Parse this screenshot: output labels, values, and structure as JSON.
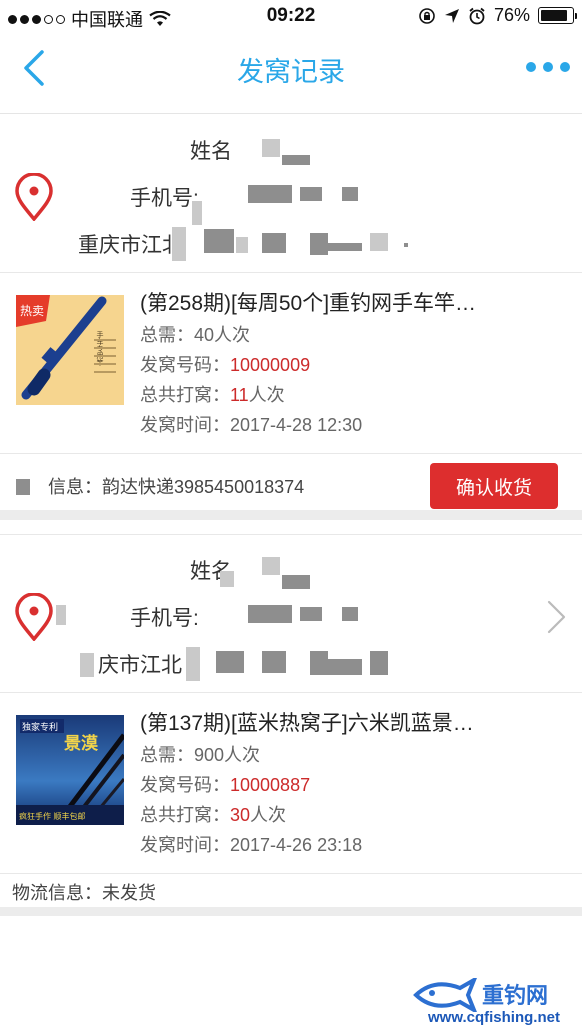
{
  "status_bar": {
    "carrier": "中国联通",
    "time": "09:22",
    "battery": "76%"
  },
  "nav": {
    "title": "发窝记录"
  },
  "records": [
    {
      "address": {
        "name_label": "姓名",
        "phone_label": "手机号:",
        "address_prefix": "重庆市江北"
      },
      "product": {
        "title": "(第258期)[每周50个]重钓网手车竿…",
        "total_label": "总需：",
        "total_value": "40人次",
        "number_label": "发窝号码：",
        "number_value": "10000009",
        "hits_label": "总共打窝：",
        "hits_value": "11",
        "hits_unit": "人次",
        "time_label": "发窝时间：",
        "time_value": "2017-4-28 12:30",
        "thumb_badge": "热卖",
        "thumb_caption": "手车专用竿"
      },
      "logistics": {
        "text": "信息：韵达快递3985450018374",
        "button_label": "确认收货"
      }
    },
    {
      "address": {
        "name_label": "姓名",
        "phone_label": "手机号:",
        "address_prefix": "庆市江北"
      },
      "product": {
        "title": "(第137期)[蓝米热窝子]六米凯蓝景…",
        "total_label": "总需：",
        "total_value": "900人次",
        "number_label": "发窝号码：",
        "number_value": "10000887",
        "hits_label": "总共打窝：",
        "hits_value": "30",
        "hits_unit": "人次",
        "time_label": "发窝时间：",
        "time_value": "2017-4-26 23:18",
        "thumb_badge": "独家专利",
        "thumb_title": "景漠",
        "thumb_footer": "疯狂手作  顺丰包邮"
      },
      "logistics": {
        "text": "物流信息：未发货"
      }
    }
  ],
  "watermark": {
    "brand": "重钓网",
    "url": "www.cqfishing.net"
  },
  "colors": {
    "accent": "#2aa7e8",
    "red": "#dd2e2e",
    "text_red": "#cc2a2a"
  }
}
